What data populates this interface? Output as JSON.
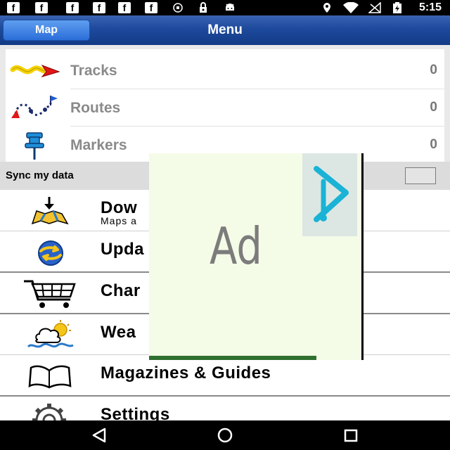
{
  "status_bar": {
    "facebook_glyph": "f",
    "time": "5:15",
    "icons": [
      "facebook-icon",
      "facebook-icon",
      "facebook-icon",
      "facebook-icon",
      "facebook-icon",
      "facebook-icon",
      "vpn-icon",
      "lock-icon",
      "android-icon",
      "location-icon",
      "wifi-icon",
      "no-signal-icon",
      "battery-charging-icon"
    ]
  },
  "header": {
    "map_button": "Map",
    "title": "Menu",
    "accent": "#1e4a9d"
  },
  "data_panel": {
    "rows": [
      {
        "label": "Tracks",
        "count": "0",
        "icon": "track-arrow-icon"
      },
      {
        "label": "Routes",
        "count": "0",
        "icon": "route-icon"
      },
      {
        "label": "Markers",
        "count": "0",
        "icon": "marker-pin-icon"
      }
    ]
  },
  "sync": {
    "label": "Sync my data"
  },
  "menu": {
    "items": [
      {
        "label": "Dow",
        "sub": "Maps a",
        "icon": "download-maps-icon"
      },
      {
        "label": "Upda",
        "icon": "update-globe-icon"
      },
      {
        "label": "Char",
        "icon": "shopping-cart-icon"
      },
      {
        "label": "Wea",
        "icon": "weather-icon"
      },
      {
        "label": "Magazines & Guides",
        "icon": "open-book-icon"
      },
      {
        "label": "Settings",
        "icon": "gear-icon"
      }
    ]
  },
  "ad": {
    "label": "Ad",
    "icon": "adchoices-play-icon"
  },
  "nav_bar": {
    "icons": [
      "back-icon",
      "home-icon",
      "recents-icon"
    ]
  }
}
